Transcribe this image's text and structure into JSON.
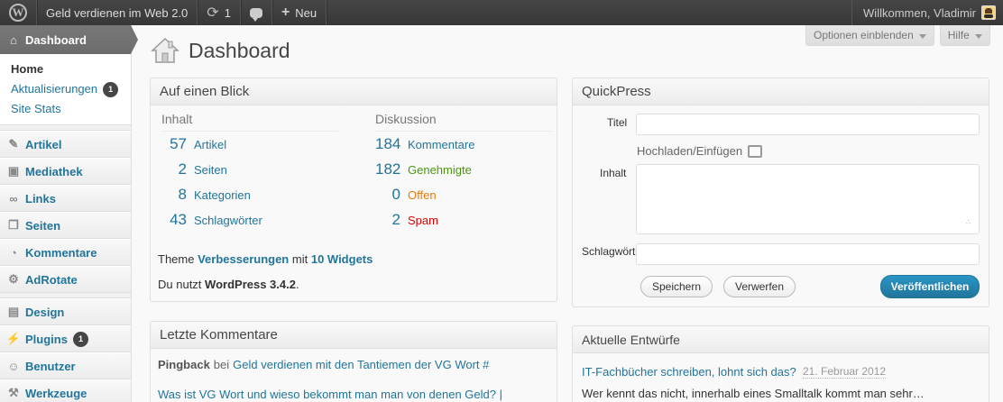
{
  "adminbar": {
    "site_name": "Geld verdienen im Web 2.0",
    "updates_count": "1",
    "new_label": "Neu",
    "welcome": "Willkommen, Vladimir"
  },
  "sidebar": {
    "dashboard_label": "Dashboard",
    "dashboard_sub": [
      {
        "label": "Home",
        "current": true
      },
      {
        "label": "Aktualisierungen",
        "badge": "1"
      },
      {
        "label": "Site Stats"
      }
    ],
    "items": [
      {
        "label": "Artikel",
        "icon": "pin-icon"
      },
      {
        "label": "Mediathek",
        "icon": "media-icon"
      },
      {
        "label": "Links",
        "icon": "link-icon"
      },
      {
        "label": "Seiten",
        "icon": "pages-icon"
      },
      {
        "label": "Kommentare",
        "icon": "comments-icon"
      },
      {
        "label": "AdRotate",
        "icon": "gear-icon"
      },
      {
        "label": "Design",
        "icon": "appearance-icon"
      },
      {
        "label": "Plugins",
        "icon": "plugin-icon",
        "badge": "1"
      },
      {
        "label": "Benutzer",
        "icon": "users-icon"
      },
      {
        "label": "Werkzeuge",
        "icon": "tools-icon"
      }
    ]
  },
  "screen_options": {
    "options_label": "Optionen einblenden",
    "help_label": "Hilfe"
  },
  "page": {
    "title": "Dashboard"
  },
  "rightnow": {
    "title": "Auf einen Blick",
    "content_heading": "Inhalt",
    "discussion_heading": "Diskussion",
    "content": [
      {
        "num": "57",
        "label": "Artikel"
      },
      {
        "num": "2",
        "label": "Seiten"
      },
      {
        "num": "8",
        "label": "Kategorien"
      },
      {
        "num": "43",
        "label": "Schlagwörter"
      }
    ],
    "discussion": [
      {
        "num": "184",
        "label": "Kommentare",
        "color": "#21759b"
      },
      {
        "num": "182",
        "label": "Genehmigte",
        "color": "#4c9611"
      },
      {
        "num": "0",
        "label": "Offen",
        "color": "#ea7a05"
      },
      {
        "num": "2",
        "label": "Spam",
        "color": "#dd0000"
      }
    ],
    "theme_prefix": "Theme",
    "theme_name": "Verbesserungen",
    "theme_mid": "mit",
    "widgets": "10 Widgets",
    "version_prefix": "Du nutzt",
    "version": "WordPress 3.4.2",
    "version_suffix": "."
  },
  "quickpress": {
    "title": "QuickPress",
    "title_label": "Titel",
    "upload_label": "Hochladen/Einfügen",
    "content_label": "Inhalt",
    "tags_label": "Schlagwörter",
    "save_label": "Speichern",
    "discard_label": "Verwerfen",
    "publish_label": "Veröffentlichen"
  },
  "recent_comments": {
    "title": "Letzte Kommentare",
    "type": "Pingback",
    "by": "bei",
    "post_link": "Geld verdienen mit den Tantiemen der VG Wort #",
    "second_line": "Was ist VG Wort und wieso bekommt man man von denen Geld? |"
  },
  "recent_drafts": {
    "title": "Aktuelle Entwürfe",
    "draft_title": "IT-Fachbücher schreiben, lohnt sich das?",
    "draft_date": "21. Februar 2012",
    "excerpt": "Wer kennt das nicht, innerhalb eines Smalltalk kommt man sehr…"
  }
}
